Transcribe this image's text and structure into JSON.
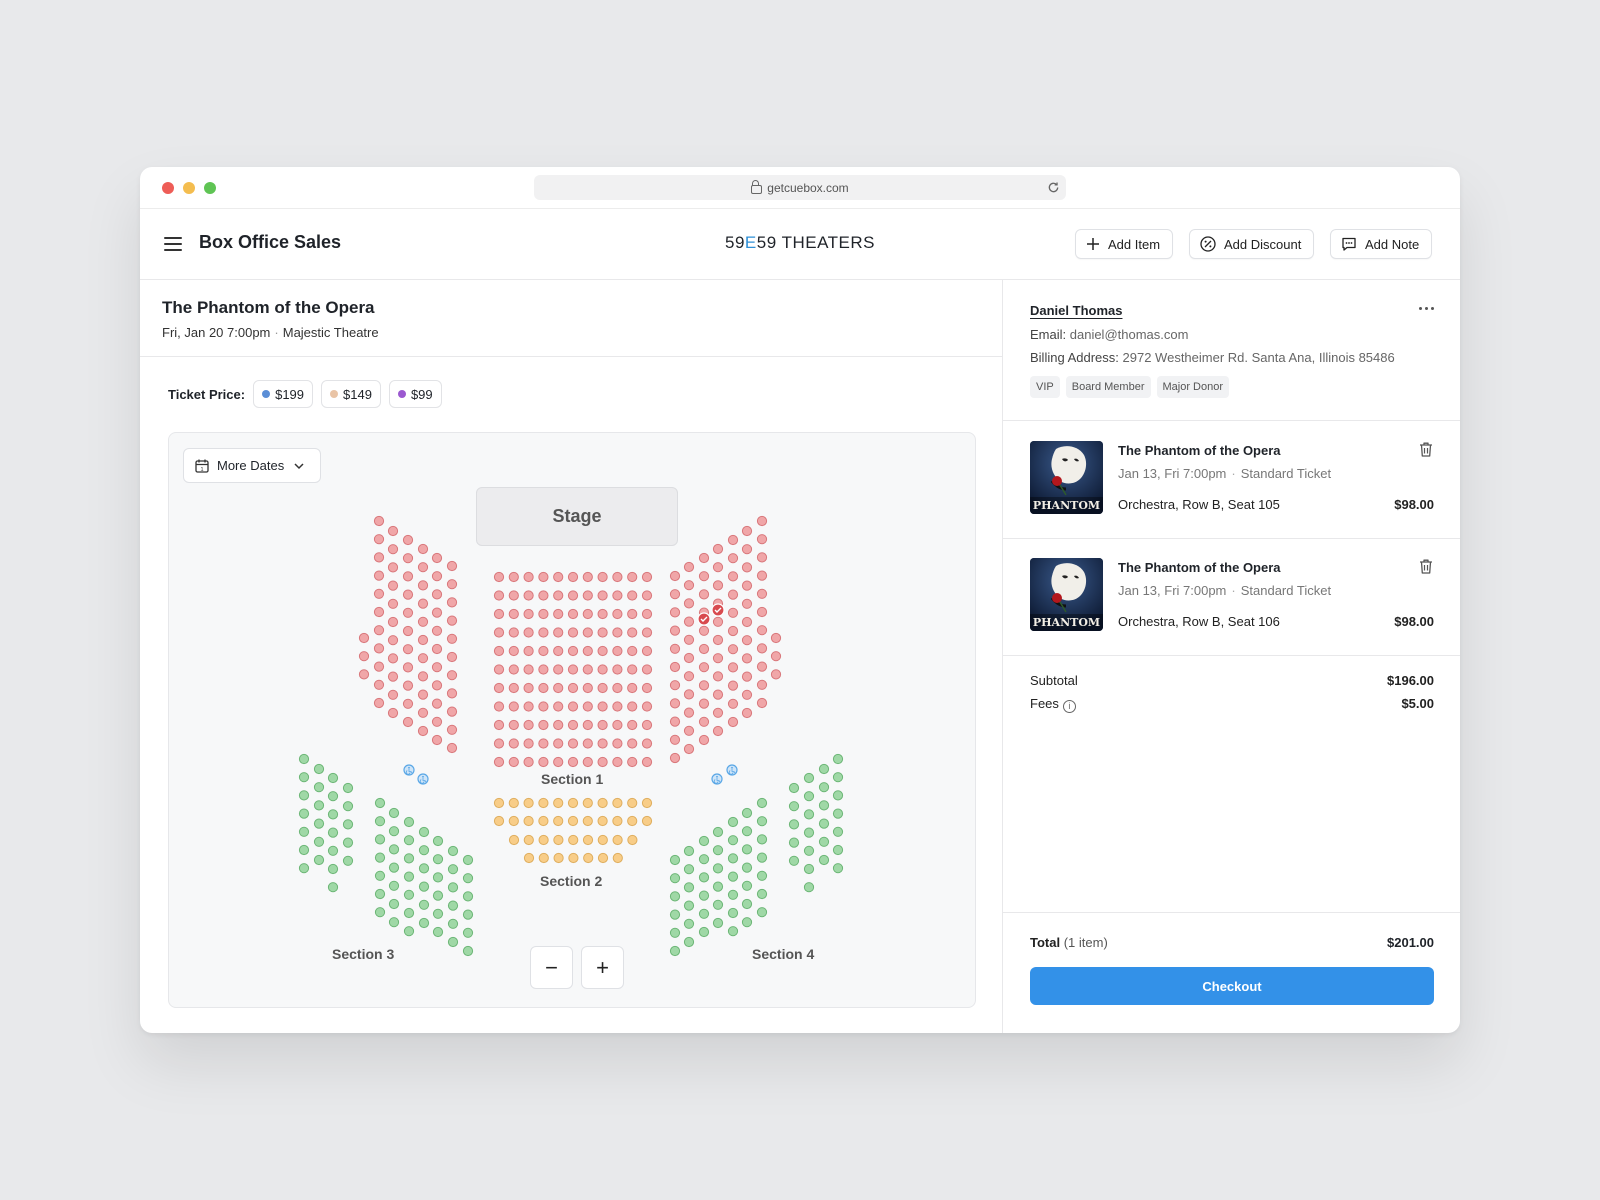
{
  "browser": {
    "url": "getcuebox.com"
  },
  "header": {
    "app_title": "Box Office Sales",
    "brand_prefix": "59",
    "brand_accent": "E",
    "brand_suffix": "59 THEATERS",
    "add_item": "Add Item",
    "add_discount": "Add Discount",
    "add_note": "Add Note"
  },
  "event": {
    "title": "The Phantom of the Opera",
    "date": "Fri, Jan 20 7:00pm",
    "venue": "Majestic Theatre"
  },
  "pricing": {
    "label": "Ticket Price:",
    "tiers": [
      {
        "label": "$199",
        "color": "#5b8ed6"
      },
      {
        "label": "$149",
        "color": "#e9c4a6"
      },
      {
        "label": "$99",
        "color": "#9b59d0"
      }
    ]
  },
  "seatmap": {
    "more_dates": "More Dates",
    "stage": "Stage",
    "sections": [
      "Section 1",
      "Section 2",
      "Section 3",
      "Section 4"
    ],
    "zoom_out": "−",
    "zoom_in": "+",
    "colors": {
      "red": "#f0a6a8",
      "orange": "#f8cd88",
      "green": "#9fd8a6",
      "selected": "#d84a4f",
      "accessible": "#5aa7e6"
    }
  },
  "customer": {
    "name": "Daniel Thomas",
    "email_label": "Email:",
    "email": "daniel@thomas.com",
    "billing_label": "Billing Address:",
    "billing": "2972 Westheimer Rd. Santa Ana, Illinois 85486",
    "tags": [
      "VIP",
      "Board Member",
      "Major Donor"
    ]
  },
  "cart": {
    "items": [
      {
        "title": "The Phantom of the Opera",
        "date": "Jan 13, Fri 7:00pm",
        "type": "Standard Ticket",
        "seat": "Orchestra, Row B, Seat 105",
        "price": "$98.00",
        "poster_text": "PHANTOM"
      },
      {
        "title": "The Phantom of the Opera",
        "date": "Jan 13, Fri 7:00pm",
        "type": "Standard Ticket",
        "seat": "Orchestra, Row B, Seat 106",
        "price": "$98.00",
        "poster_text": "PHANTOM"
      }
    ],
    "subtotal_label": "Subtotal",
    "subtotal": "$196.00",
    "fees_label": "Fees",
    "fees": "$5.00",
    "total_label": "Total",
    "total_count": "(1 item)",
    "total": "$201.00",
    "checkout": "Checkout"
  }
}
